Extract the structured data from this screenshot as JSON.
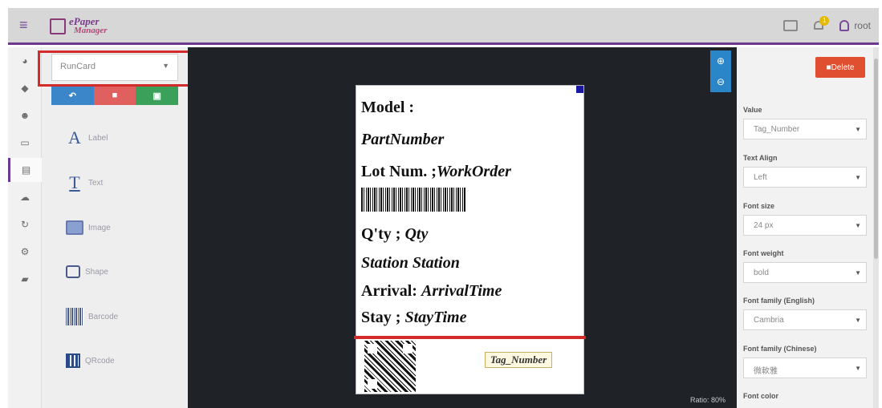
{
  "header": {
    "logo_line1": "ePaper",
    "logo_line2": "Manager",
    "notification_count": "1",
    "user": "root"
  },
  "sidebar_rail": {
    "icons": [
      "dashboard-icon",
      "tag-icon",
      "user-icon",
      "monitor-icon",
      "template-icon",
      "cloud-icon",
      "sync-icon",
      "settings-icon",
      "book-icon"
    ],
    "active_index": 4
  },
  "tool_panel": {
    "template_select": "RunCard",
    "action_buttons": [
      "undo",
      "delete",
      "save"
    ],
    "tools": [
      {
        "label": "Label",
        "glyph": "A"
      },
      {
        "label": "Text",
        "glyph": "T"
      },
      {
        "label": "Image",
        "glyph": ""
      },
      {
        "label": "Shape",
        "glyph": ""
      },
      {
        "label": "Barcode",
        "glyph": ""
      },
      {
        "label": "QRcode",
        "glyph": ""
      }
    ]
  },
  "canvas": {
    "zoom_in": "+",
    "zoom_out": "-",
    "ratio": "Ratio: 80%"
  },
  "epaper": {
    "line1_label": "Model :",
    "line2_value": "PartNumber",
    "line3_label": "Lot Num. ;",
    "line3_value": "WorkOrder",
    "line4_label": "Q'ty ;",
    "line4_value": "Qty",
    "line5_label": "Station",
    "line5_value": "Station",
    "line6_label": "Arrival:",
    "line6_value": "ArrivalTime",
    "line7_label": "Stay ;",
    "line7_value": "StayTime",
    "tag_field": "Tag_Number"
  },
  "properties": {
    "delete_label": "Delete",
    "fields": [
      {
        "label": "Value",
        "value": "Tag_Number"
      },
      {
        "label": "Text Align",
        "value": "Left"
      },
      {
        "label": "Font size",
        "value": "24 px"
      },
      {
        "label": "Font weight",
        "value": "bold"
      },
      {
        "label": "Font family (English)",
        "value": "Cambria"
      },
      {
        "label": "Font family (Chinese)",
        "value": "微軟雅"
      },
      {
        "label": "Font color",
        "value": ""
      }
    ]
  },
  "colors": {
    "accent": "#6b3a8c",
    "highlight_red": "#d32a2a",
    "delete_orange": "#e05030",
    "zoom_blue": "#2a86c8"
  }
}
